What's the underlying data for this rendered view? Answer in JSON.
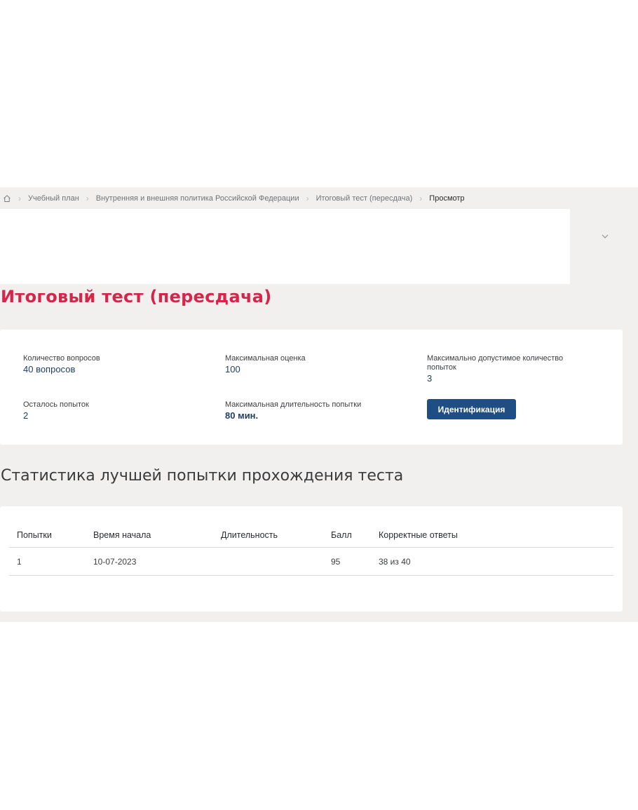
{
  "breadcrumb": {
    "home_icon": "home-icon",
    "items": [
      {
        "label": "Учебный план"
      },
      {
        "label": "Внутренняя и внешняя политика Российской Федерации"
      },
      {
        "label": "Итоговый тест (пересдача)"
      },
      {
        "label": "Просмотр"
      }
    ]
  },
  "collapse": {
    "icon": "chevron-down-icon"
  },
  "page": {
    "title": "Итоговый тест (пересдача)"
  },
  "info": {
    "questions_label": "Количество вопросов",
    "questions_value": "40 вопросов",
    "max_score_label": "Максимальная оценка",
    "max_score_value": "100",
    "max_attempts_label": "Максимально допустимое количество попыток",
    "max_attempts_value": "3",
    "remaining_label": "Осталось попыток",
    "remaining_value": "2",
    "max_duration_label": "Максимальная длительность попытки",
    "max_duration_value": "80 мин.",
    "ident_button": "Идентификация"
  },
  "stats": {
    "title": "Статистика лучшей попытки прохождения теста",
    "columns": [
      "Попытки",
      "Время начала",
      "Длительность",
      "Балл",
      "Корректные ответы"
    ],
    "rows": [
      {
        "attempt": "1",
        "start": "10-07-2023",
        "duration": "",
        "score": "95",
        "correct": "38 из 40"
      }
    ]
  },
  "colors": {
    "accent_red": "#d6254a",
    "button_blue": "#1f4e84",
    "value_blue": "#1f3f66",
    "background": "#f1f0ef"
  }
}
